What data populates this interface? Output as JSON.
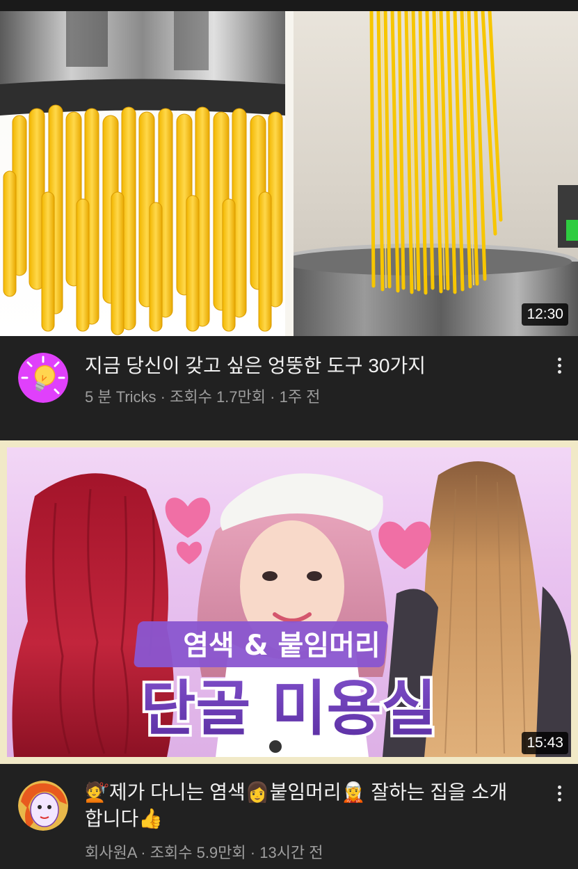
{
  "videos": [
    {
      "title": "지금 당신이 갖고 싶은 엉뚱한 도구 30가지",
      "channel": "5 분 Tricks",
      "views": "조회수 1.7만회",
      "age": "1주 전",
      "duration": "12:30",
      "avatar_icon": "lightbulb-icon",
      "avatar_color": "#e040fb"
    },
    {
      "title_parts": [
        "제가 다니는 염색",
        "붙임머리",
        " 잘하는 집을 소개",
        "합니다"
      ],
      "emoji": [
        "💇",
        "👩",
        "🧝",
        "👍"
      ],
      "channel": "회사원A",
      "views": "조회수 5.9만회",
      "age": "13시간 전",
      "duration": "15:43",
      "thumbnail_text": {
        "line1": "염색 & 붙임머리",
        "line2": "단골 미용실"
      }
    }
  ],
  "separator": " · ",
  "colors": {
    "background": "#212121",
    "title": "#f1f1f1",
    "meta": "#9e9e9e",
    "thumb_banner": "#9b59d6"
  }
}
